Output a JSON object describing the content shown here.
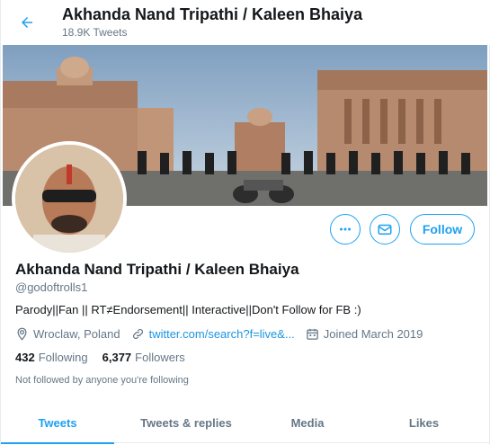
{
  "header": {
    "title": "Akhanda Nand Tripathi / Kaleen Bhaiya",
    "tweet_count": "18.9K Tweets"
  },
  "profile": {
    "name": "Akhanda Nand Tripathi / Kaleen Bhaiya",
    "handle": "@godoftrolls1",
    "bio": "Parody||Fan || RT≠Endorsement|| Interactive||Don't Follow for FB :)",
    "location": "Wroclaw, Poland",
    "website": "twitter.com/search?f=live&...",
    "joined": "Joined March 2019",
    "following_count": "432",
    "following_label": "Following",
    "followers_count": "6,377",
    "followers_label": "Followers",
    "not_followed_text": "Not followed by anyone you're following"
  },
  "actions": {
    "follow_label": "Follow"
  },
  "tabs": [
    {
      "label": "Tweets",
      "active": true
    },
    {
      "label": "Tweets & replies",
      "active": false
    },
    {
      "label": "Media",
      "active": false
    },
    {
      "label": "Likes",
      "active": false
    }
  ],
  "colors": {
    "accent": "#1da1f2",
    "link": "#1b95e0",
    "muted": "#657786",
    "text": "#14171a"
  },
  "icons": {
    "back": "arrow-left-icon",
    "more": "more-horizontal-icon",
    "message": "envelope-icon",
    "location": "location-pin-icon",
    "link": "link-icon",
    "calendar": "calendar-icon"
  }
}
